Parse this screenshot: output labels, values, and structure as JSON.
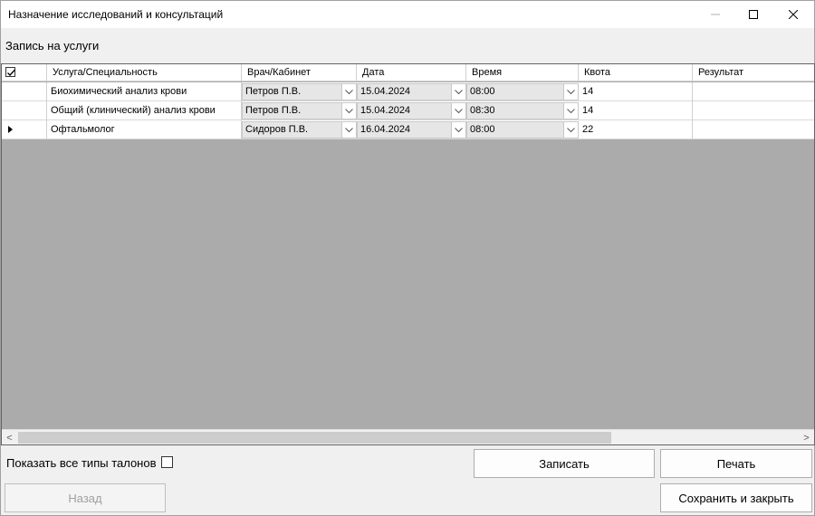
{
  "window": {
    "title": "Назначение исследований и консультаций"
  },
  "section_label": "Запись на услуги",
  "grid": {
    "columns": [
      "",
      "Услуга/Специальность",
      "Врач/Кабинет",
      "Дата",
      "Время",
      "Квота",
      "Результат"
    ],
    "rows": [
      {
        "service": "Биохимический анализ крови",
        "doctor": "Петров П.В.",
        "date": "15.04.2024",
        "time": "08:00",
        "quota": "14",
        "result": "",
        "current": false
      },
      {
        "service": "Общий (клинический) анализ крови",
        "doctor": "Петров П.В.",
        "date": "15.04.2024",
        "time": "08:30",
        "quota": "14",
        "result": "",
        "current": false
      },
      {
        "service": "Офтальмолог",
        "doctor": "Сидоров П.В.",
        "date": "16.04.2024",
        "time": "08:00",
        "quota": "22",
        "result": "",
        "current": true
      }
    ],
    "scrollbar": {
      "left_arrow": "<",
      "right_arrow": ">"
    }
  },
  "options": {
    "show_all_ticket_types_label": "Показать все типы талонов",
    "show_all_ticket_types_checked": false
  },
  "buttons": {
    "register": "Записать",
    "print": "Печать",
    "back": "Назад",
    "save_close": "Сохранить и закрыть"
  },
  "colors": {
    "grid_background": "#ababab",
    "combo_background": "#e6e6e6"
  }
}
